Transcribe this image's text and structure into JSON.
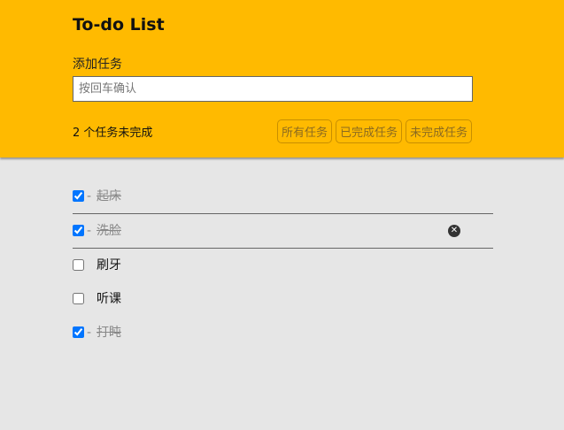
{
  "header": {
    "title": "To-do List",
    "add_label": "添加任务",
    "input_placeholder": "按回车确认",
    "input_value": "",
    "remaining_text": "2 个任务未完成",
    "filters": [
      "所有任务",
      "已完成任务",
      "未完成任务"
    ]
  },
  "tasks": [
    {
      "label": "起床",
      "done": true
    },
    {
      "label": "洗脸",
      "done": true
    },
    {
      "label": "刷牙",
      "done": false
    },
    {
      "label": "听课",
      "done": false
    },
    {
      "label": "打盹",
      "done": true
    }
  ],
  "dash": "-",
  "icons": {
    "delete": "close-circle-icon"
  },
  "colors": {
    "accent": "#ffba00",
    "background": "#e6e6e6"
  }
}
